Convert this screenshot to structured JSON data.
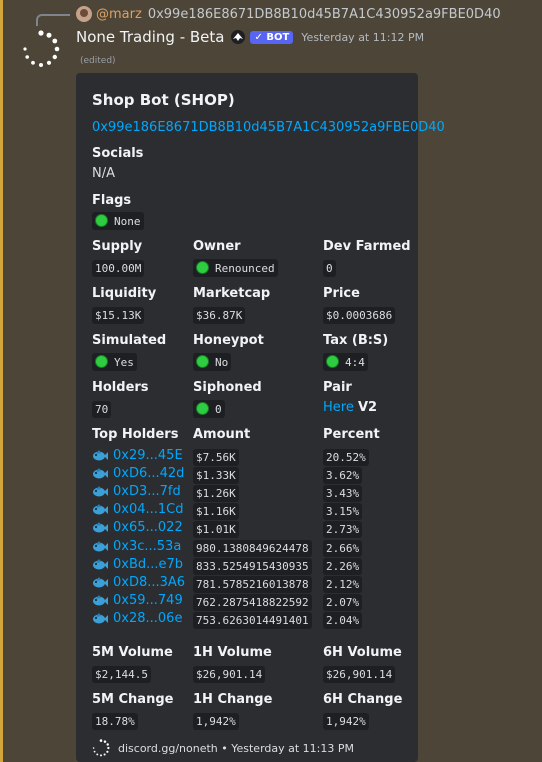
{
  "reply": {
    "username": "@marz",
    "text": "0x99e186E8671DB8B10d45B7A1C430952a9FBE0D40"
  },
  "message": {
    "author": "None Trading - Beta",
    "bot_tag": "✓ BOT",
    "timestamp": "Yesterday at 11:12 PM",
    "edited": "(edited)"
  },
  "embed": {
    "title": "Shop Bot (SHOP)",
    "contract": "0x99e186E8671DB8B10d45B7A1C430952a9FBE0D40",
    "socials": {
      "name": "Socials",
      "value": "N/A"
    },
    "flags": {
      "name": "Flags",
      "value": "None"
    },
    "supply": {
      "name": "Supply",
      "value": "100.00M"
    },
    "owner": {
      "name": "Owner",
      "value": "Renounced"
    },
    "dev_farmed": {
      "name": "Dev Farmed",
      "value": "0"
    },
    "liquidity": {
      "name": "Liquidity",
      "value": "$15.13K"
    },
    "marketcap": {
      "name": "Marketcap",
      "value": "$36.87K"
    },
    "price": {
      "name": "Price",
      "value": "$0.0003686"
    },
    "simulated": {
      "name": "Simulated",
      "value": "Yes"
    },
    "honeypot": {
      "name": "Honeypot",
      "value": "No"
    },
    "tax": {
      "name": "Tax (B:S)",
      "value": "4:4"
    },
    "holders": {
      "name": "Holders",
      "value": "70"
    },
    "siphoned": {
      "name": "Siphoned",
      "value": "0"
    },
    "pair": {
      "name": "Pair",
      "link": "Here",
      "version": "V2"
    },
    "top_holders_header": "Top Holders",
    "amount_header": "Amount",
    "percent_header": "Percent",
    "top_holders": [
      {
        "address": "0x29...45E",
        "amount": "$7.56K",
        "percent": "20.52%"
      },
      {
        "address": "0xD6...42d",
        "amount": "$1.33K",
        "percent": "3.62%"
      },
      {
        "address": "0xD3...7fd",
        "amount": "$1.26K",
        "percent": "3.43%"
      },
      {
        "address": "0x04...1Cd",
        "amount": "$1.16K",
        "percent": "3.15%"
      },
      {
        "address": "0x65...022",
        "amount": "$1.01K",
        "percent": "2.73%"
      },
      {
        "address": "0x3c...53a",
        "amount": "980.1380849624478",
        "percent": "2.66%"
      },
      {
        "address": "0xBd...e7b",
        "amount": "833.5254915430935",
        "percent": "2.26%"
      },
      {
        "address": "0xD8...3A6",
        "amount": "781.5785216013878",
        "percent": "2.12%"
      },
      {
        "address": "0x59...749",
        "amount": "762.2875418822592",
        "percent": "2.07%"
      },
      {
        "address": "0x28...06e",
        "amount": "753.6263014491401",
        "percent": "2.04%"
      }
    ],
    "vol_5m": {
      "name": "5M Volume",
      "value": "$2,144.5"
    },
    "vol_1h": {
      "name": "1H Volume",
      "value": "$26,901.14"
    },
    "vol_6h": {
      "name": "6H Volume",
      "value": "$26,901.14"
    },
    "chg_5m": {
      "name": "5M Change",
      "value": "18.78%"
    },
    "chg_1h": {
      "name": "1H Change",
      "value": "1,942%"
    },
    "chg_6h": {
      "name": "6H Change",
      "value": "1,942%"
    },
    "footer": "discord.gg/noneth • Yesterday at 11:13 PM"
  },
  "colors": {
    "highlight_bg": "#4c4538",
    "accent_bar": "#d4a73c",
    "embed_bg": "#2b2d31",
    "link": "#00a8fc",
    "green_dot": "#2ecc40",
    "bot_tag": "#5865f2"
  },
  "icons": {
    "avatar": "spinner-ring-icon",
    "author_badge": "bot-badge-icon",
    "holder": "fish-icon",
    "footer": "spinner-ring-icon",
    "status": "green-dot-icon"
  }
}
